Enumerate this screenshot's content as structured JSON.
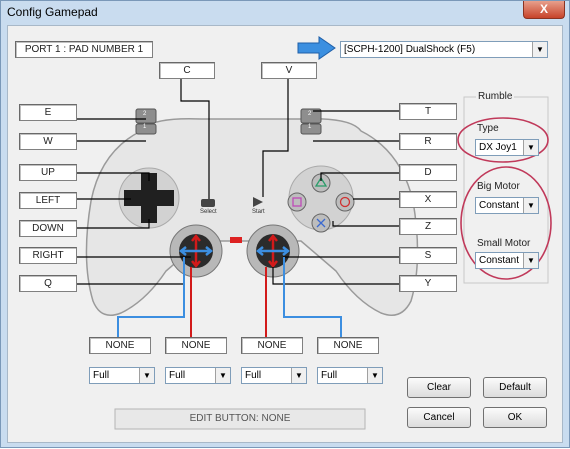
{
  "window": {
    "title": "Config Gamepad",
    "close_glyph": "X"
  },
  "port_label": "PORT 1 : PAD NUMBER 1",
  "pad_select": {
    "value": "[SCPH-1200] DualShock (F5)"
  },
  "buttons": {
    "c": "C",
    "v": "V",
    "e": "E",
    "w": "W",
    "up": "UP",
    "left": "LEFT",
    "down": "DOWN",
    "right": "RIGHT",
    "q": "Q",
    "t": "T",
    "r": "R",
    "d": "D",
    "x": "X",
    "z": "Z",
    "s": "S",
    "y": "Y"
  },
  "controller": {
    "select_label": "Select",
    "start_label": "Start",
    "l2": "2",
    "l1": "1",
    "r2": "2",
    "r1": "1"
  },
  "analog": [
    {
      "value": "NONE",
      "mode": "Full"
    },
    {
      "value": "NONE",
      "mode": "Full"
    },
    {
      "value": "NONE",
      "mode": "Full"
    },
    {
      "value": "NONE",
      "mode": "Full"
    }
  ],
  "rumble": {
    "group_label": "Rumble",
    "type_label": "Type",
    "type_value": "DX Joy1",
    "big_label": "Big Motor",
    "big_value": "Constant",
    "small_label": "Small Motor",
    "small_value": "Constant"
  },
  "edit_status": "EDIT BUTTON: NONE",
  "actions": {
    "clear": "Clear",
    "default": "Default",
    "cancel": "Cancel",
    "ok": "OK"
  },
  "colors": {
    "arrow": "#3b8fe0",
    "circle_annotation": "#c0395a",
    "red_wire": "#d21a1a",
    "blue_wire": "#3c8ee0"
  }
}
